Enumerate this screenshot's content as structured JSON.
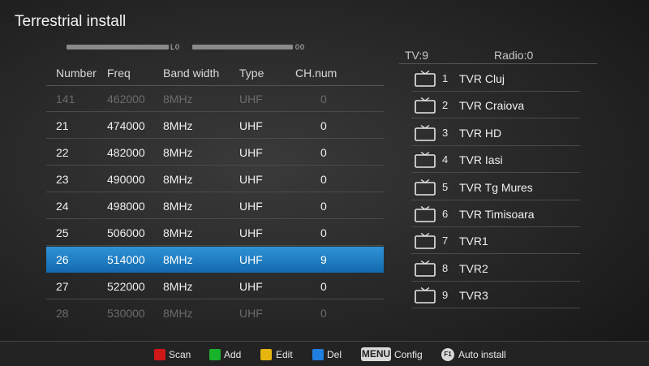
{
  "title": "Terrestrial install",
  "signal": {
    "strength_label": "L0",
    "quality_label": "00"
  },
  "table": {
    "headers": [
      "Number",
      "Freq",
      "Band width",
      "Type",
      "CH.num"
    ],
    "rows": [
      {
        "number": "141",
        "freq": "462000",
        "bw": "8MHz",
        "type": "UHF",
        "ch": "0",
        "dim": true
      },
      {
        "number": "21",
        "freq": "474000",
        "bw": "8MHz",
        "type": "UHF",
        "ch": "0"
      },
      {
        "number": "22",
        "freq": "482000",
        "bw": "8MHz",
        "type": "UHF",
        "ch": "0"
      },
      {
        "number": "23",
        "freq": "490000",
        "bw": "8MHz",
        "type": "UHF",
        "ch": "0"
      },
      {
        "number": "24",
        "freq": "498000",
        "bw": "8MHz",
        "type": "UHF",
        "ch": "0"
      },
      {
        "number": "25",
        "freq": "506000",
        "bw": "8MHz",
        "type": "UHF",
        "ch": "0"
      },
      {
        "number": "26",
        "freq": "514000",
        "bw": "8MHz",
        "type": "UHF",
        "ch": "9",
        "selected": true
      },
      {
        "number": "27",
        "freq": "522000",
        "bw": "8MHz",
        "type": "UHF",
        "ch": "0"
      },
      {
        "number": "28",
        "freq": "530000",
        "bw": "8MHz",
        "type": "UHF",
        "ch": "0",
        "dim": true
      }
    ]
  },
  "counts": {
    "tv": "TV:9",
    "radio": "Radio:0"
  },
  "channels": [
    {
      "num": "1",
      "name": "TVR Cluj"
    },
    {
      "num": "2",
      "name": "TVR Craiova"
    },
    {
      "num": "3",
      "name": "TVR HD"
    },
    {
      "num": "4",
      "name": "TVR Iasi"
    },
    {
      "num": "5",
      "name": "TVR Tg Mures"
    },
    {
      "num": "6",
      "name": "TVR Timisoara"
    },
    {
      "num": "7",
      "name": "TVR1"
    },
    {
      "num": "8",
      "name": "TVR2"
    },
    {
      "num": "9",
      "name": "TVR3"
    }
  ],
  "footer": {
    "scan": "Scan",
    "add": "Add",
    "edit": "Edit",
    "del": "Del",
    "menu_key": "MENU",
    "config": "Config",
    "f1_key": "F1",
    "auto_install": "Auto install"
  },
  "colors": {
    "red": "#d01818",
    "green": "#19b22b",
    "yellow": "#e5b50e",
    "blue": "#1e7fe0",
    "selection": "#1b7ac2"
  }
}
